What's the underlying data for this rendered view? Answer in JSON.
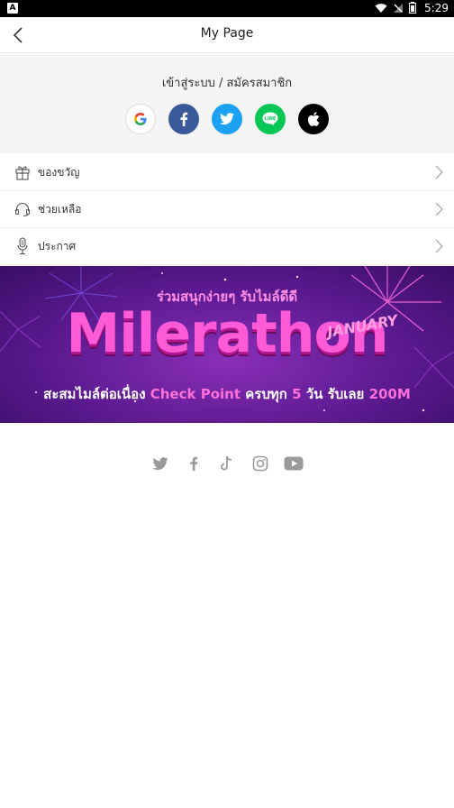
{
  "status_bar": {
    "time": "5:29",
    "app_badge": "A"
  },
  "header": {
    "title": "My Page"
  },
  "login": {
    "label": "เข้าสู่ระบบ / สมัครสมาชิก",
    "providers": [
      "google-icon",
      "facebook-icon",
      "twitter-icon",
      "line-icon",
      "apple-icon"
    ],
    "line_text": "LINE"
  },
  "menu": [
    {
      "label": "ของขวัญ",
      "icon": "gift-icon"
    },
    {
      "label": "ช่วยเหลือ",
      "icon": "headset-icon"
    },
    {
      "label": "ประกาศ",
      "icon": "microphone-icon"
    }
  ],
  "banner": {
    "top_text": "ร่วมสนุกง่ายๆ รับไมล์ดีดี",
    "title": "Milerathon",
    "month": "JANUARY",
    "bottom_prefix": "สะสมไมล์ต่อเนื่อง",
    "bottom_highlight": "Check Point",
    "bottom_mid": "ครบทุก",
    "bottom_num": "5",
    "bottom_unit": "วัน รับเลย",
    "bottom_reward": "200M"
  },
  "social_follow": [
    "twitter-icon",
    "facebook-icon",
    "tiktok-icon",
    "instagram-icon",
    "youtube-icon"
  ],
  "colors": {
    "facebook": "#3b5998",
    "twitter": "#1da1f2",
    "line": "#06c755",
    "apple": "#000000",
    "banner_bg": "#5b1a8f",
    "banner_accent": "#ff5ad8"
  }
}
